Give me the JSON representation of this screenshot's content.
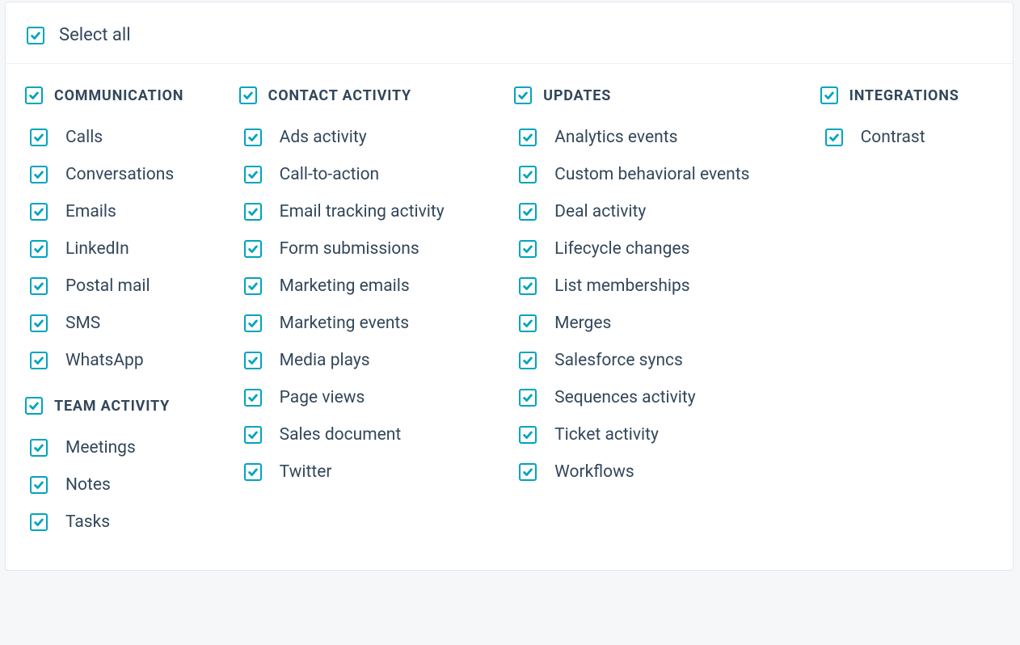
{
  "select_all": {
    "label": "Select all",
    "checked": true
  },
  "columns": [
    {
      "groups": [
        {
          "id": "communication",
          "title": "COMMUNICATION",
          "checked": true,
          "items": [
            {
              "id": "calls",
              "label": "Calls",
              "checked": true
            },
            {
              "id": "conversations",
              "label": "Conversations",
              "checked": true
            },
            {
              "id": "emails",
              "label": "Emails",
              "checked": true
            },
            {
              "id": "linkedin",
              "label": "LinkedIn",
              "checked": true
            },
            {
              "id": "postal-mail",
              "label": "Postal mail",
              "checked": true
            },
            {
              "id": "sms",
              "label": "SMS",
              "checked": true
            },
            {
              "id": "whatsapp",
              "label": "WhatsApp",
              "checked": true
            }
          ]
        },
        {
          "id": "team-activity",
          "title": "TEAM ACTIVITY",
          "checked": true,
          "items": [
            {
              "id": "meetings",
              "label": "Meetings",
              "checked": true
            },
            {
              "id": "notes",
              "label": "Notes",
              "checked": true
            },
            {
              "id": "tasks",
              "label": "Tasks",
              "checked": true
            }
          ]
        }
      ]
    },
    {
      "groups": [
        {
          "id": "contact-activity",
          "title": "CONTACT ACTIVITY",
          "checked": true,
          "items": [
            {
              "id": "ads-activity",
              "label": "Ads activity",
              "checked": true
            },
            {
              "id": "call-to-action",
              "label": "Call-to-action",
              "checked": true
            },
            {
              "id": "email-tracking-activity",
              "label": "Email tracking activity",
              "checked": true
            },
            {
              "id": "form-submissions",
              "label": "Form submissions",
              "checked": true
            },
            {
              "id": "marketing-emails",
              "label": "Marketing emails",
              "checked": true
            },
            {
              "id": "marketing-events",
              "label": "Marketing events",
              "checked": true
            },
            {
              "id": "media-plays",
              "label": "Media plays",
              "checked": true
            },
            {
              "id": "page-views",
              "label": "Page views",
              "checked": true
            },
            {
              "id": "sales-document",
              "label": "Sales document",
              "checked": true
            },
            {
              "id": "twitter",
              "label": "Twitter",
              "checked": true
            }
          ]
        }
      ]
    },
    {
      "groups": [
        {
          "id": "updates",
          "title": "UPDATES",
          "checked": true,
          "items": [
            {
              "id": "analytics-events",
              "label": "Analytics events",
              "checked": true
            },
            {
              "id": "custom-behavioral-events",
              "label": "Custom behavioral events",
              "checked": true
            },
            {
              "id": "deal-activity",
              "label": "Deal activity",
              "checked": true
            },
            {
              "id": "lifecycle-changes",
              "label": "Lifecycle changes",
              "checked": true
            },
            {
              "id": "list-memberships",
              "label": "List memberships",
              "checked": true
            },
            {
              "id": "merges",
              "label": "Merges",
              "checked": true
            },
            {
              "id": "salesforce-syncs",
              "label": "Salesforce syncs",
              "checked": true
            },
            {
              "id": "sequences-activity",
              "label": "Sequences activity",
              "checked": true
            },
            {
              "id": "ticket-activity",
              "label": "Ticket activity",
              "checked": true
            },
            {
              "id": "workflows",
              "label": "Workflows",
              "checked": true
            }
          ]
        }
      ]
    },
    {
      "groups": [
        {
          "id": "integrations",
          "title": "INTEGRATIONS",
          "checked": true,
          "items": [
            {
              "id": "contrast",
              "label": "Contrast",
              "checked": true
            }
          ]
        }
      ]
    }
  ]
}
